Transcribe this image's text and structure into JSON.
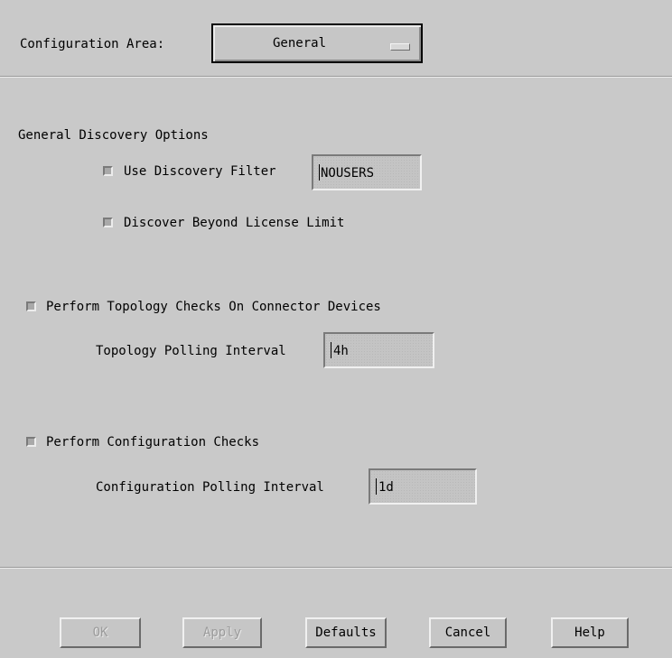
{
  "config_area": {
    "label": "Configuration Area:",
    "selected": "General"
  },
  "general_discovery": {
    "heading": "General Discovery Options",
    "use_filter_label": "Use Discovery Filter",
    "filter_value": "NOUSERS",
    "beyond_limit_label": "Discover Beyond License Limit"
  },
  "topology": {
    "check_label": "Perform Topology Checks On Connector Devices",
    "interval_label": "Topology Polling Interval",
    "interval_value": "4h"
  },
  "configuration": {
    "check_label": "Perform Configuration Checks",
    "interval_label": "Configuration Polling Interval",
    "interval_value": "1d"
  },
  "buttons": {
    "ok": "OK",
    "apply": "Apply",
    "defaults": "Defaults",
    "cancel": "Cancel",
    "help": "Help"
  },
  "colors": {
    "background": "#c9c9c9",
    "disabled_text": "#9c9c9c"
  }
}
